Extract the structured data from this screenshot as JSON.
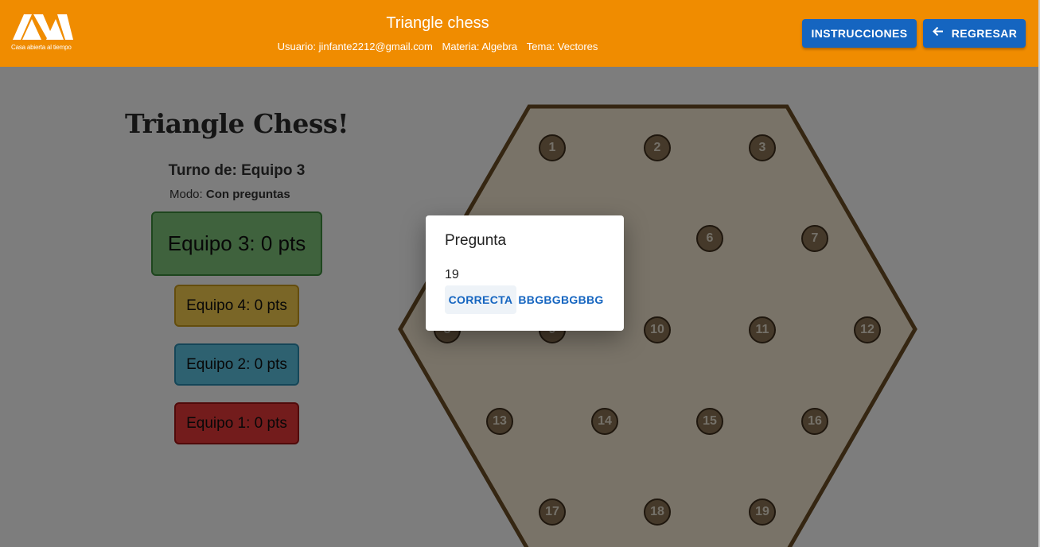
{
  "header": {
    "logo_caption": "Casa abierta al tiempo",
    "title": "Triangle chess",
    "user": "Usuario: jinfante2212@gmail.com",
    "subject": "Materia: Algebra",
    "topic": "Tema: Vectores",
    "instructions_label": "INSTRUCCIONES",
    "back_label": "REGRESAR",
    "back_icon": "arrow-left-icon"
  },
  "panel": {
    "title": "Triangle Chess!",
    "turn": "Turno de: Equipo 3",
    "mode_label": "Modo:",
    "mode_value": "Con preguntas",
    "teams": [
      {
        "label": "Equipo 3: 0 pts",
        "color": "#7ec57a"
      },
      {
        "label": "Equipo 4: 0 pts",
        "color": "#f5cd4f"
      },
      {
        "label": "Equipo 2: 0 pts",
        "color": "#5cc2e0"
      },
      {
        "label": "Equipo 1: 0 pts",
        "color": "#e73939"
      }
    ]
  },
  "board": {
    "nodes": [
      "1",
      "2",
      "3",
      "6",
      "7",
      "8",
      "9",
      "10",
      "11",
      "12",
      "13",
      "14",
      "15",
      "16",
      "17",
      "18",
      "19"
    ]
  },
  "dialog": {
    "title": "Pregunta",
    "body": "19",
    "correct_label": "CORRECTA",
    "other_label": "BBGBGBGBBG"
  },
  "colors": {
    "header": "#f08c00",
    "button": "#1565c0",
    "board_fill": "#f3e6d0",
    "board_stroke": "#6b4d24"
  }
}
